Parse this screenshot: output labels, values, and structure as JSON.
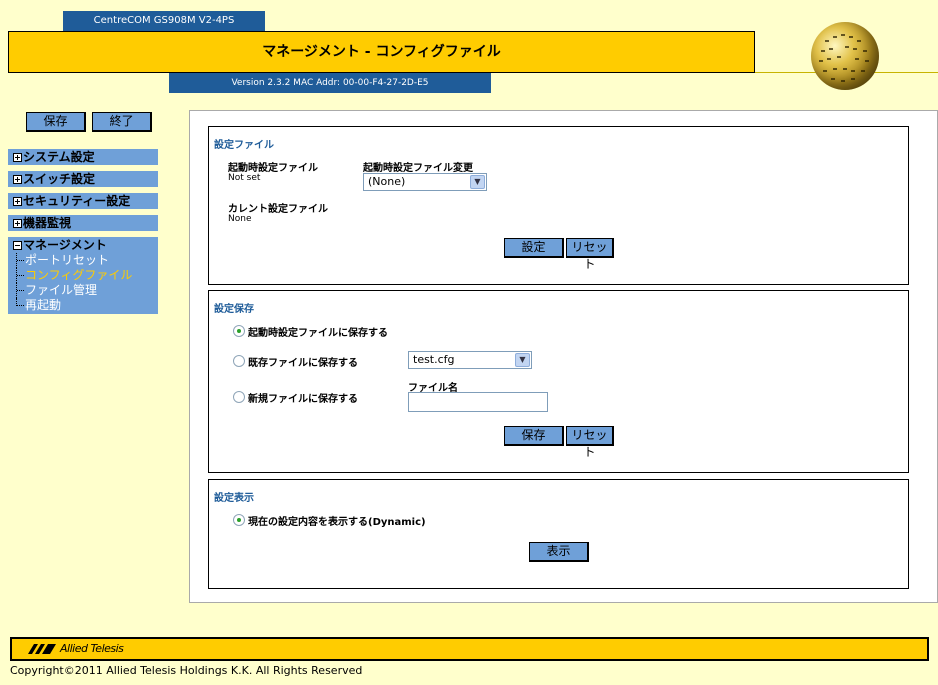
{
  "header": {
    "model": "CentreCOM GS908M V2-4PS",
    "title": "マネージメント - コンフィグファイル",
    "version": "Version 2.3.2 MAC Addr: 00-00-F4-27-2D-E5"
  },
  "nav": {
    "save_label": "保存",
    "exit_label": "終了",
    "sections": [
      "システム設定",
      "スイッチ設定",
      "セキュリティー設定",
      "機器監視",
      "マネージメント"
    ],
    "management_items": [
      "ポートリセット",
      "コンフィグファイル",
      "ファイル管理",
      "再起動"
    ]
  },
  "config_file": {
    "title": "設定ファイル",
    "startup_label": "起動時設定ファイル",
    "startup_value": "Not set",
    "change_label": "起動時設定ファイル変更",
    "change_selected": "(None)",
    "current_label": "カレント設定ファイル",
    "current_value": "None",
    "apply_label": "設定",
    "reset_label": "リセット"
  },
  "config_save": {
    "title": "設定保存",
    "opt_startup": "起動時設定ファイルに保存する",
    "opt_existing": "既存ファイルに保存する",
    "existing_selected": "test.cfg",
    "opt_new": "新規ファイルに保存する",
    "filename_label": "ファイル名",
    "filename_value": "",
    "save_label": "保存",
    "reset_label": "リセット"
  },
  "config_show": {
    "title": "設定表示",
    "opt_dynamic": "現在の設定内容を表示する(Dynamic)",
    "show_label": "表示"
  },
  "footer": {
    "brand": "Allied Telesis",
    "copyright": "Copyright©2011 Allied Telesis Holdings K.K. All Rights Reserved"
  }
}
